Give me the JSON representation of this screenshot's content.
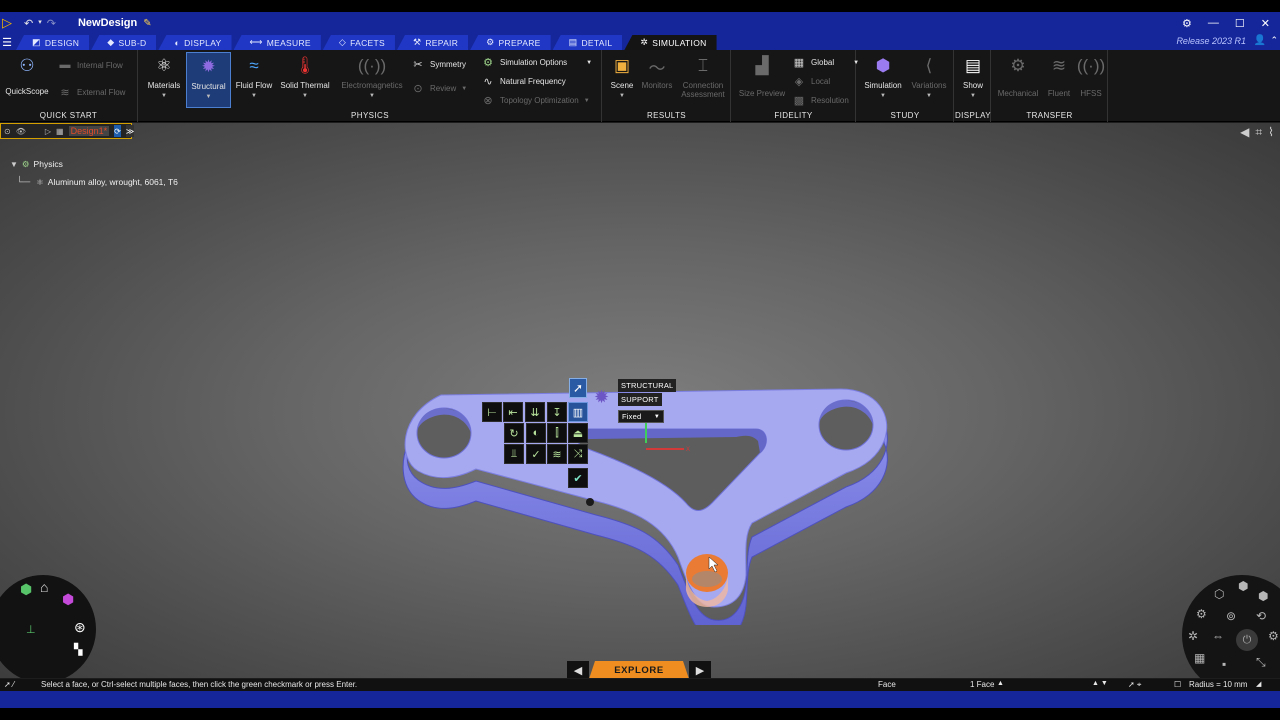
{
  "titlebar": {
    "doc_title": "NewDesign",
    "window_controls": [
      "⚙",
      "—",
      "☐",
      "✕"
    ]
  },
  "tabs": [
    {
      "label": "Design",
      "icon": "design-icon",
      "active": false
    },
    {
      "label": "Sub-D",
      "icon": "subd-icon",
      "active": false
    },
    {
      "label": "Display",
      "icon": "display-icon",
      "active": false
    },
    {
      "label": "Measure",
      "icon": "measure-icon",
      "active": false
    },
    {
      "label": "Facets",
      "icon": "facets-icon",
      "active": false
    },
    {
      "label": "Repair",
      "icon": "repair-icon",
      "active": false
    },
    {
      "label": "Prepare",
      "icon": "prepare-icon",
      "active": false
    },
    {
      "label": "Detail",
      "icon": "detail-icon",
      "active": false
    },
    {
      "label": "Simulation",
      "icon": "simulation-icon",
      "active": true
    }
  ],
  "release": "Release 2023 R1",
  "ribbon": {
    "quick_start": {
      "title": "Quick Start",
      "quickscope": "QuickScope",
      "internal_flow": "Internal Flow",
      "external_flow": "External Flow"
    },
    "physics": {
      "title": "Physics",
      "materials": "Materials",
      "structural": "Structural",
      "fluid_flow": "Fluid Flow",
      "solid_thermal": "Solid Thermal",
      "electromagnetics": "Electromagnetics",
      "symmetry": "Symmetry",
      "review": "Review",
      "simulation_options": "Simulation Options",
      "natural_frequency": "Natural Frequency",
      "topology_optimization": "Topology Optimization"
    },
    "results": {
      "title": "Results",
      "scene": "Scene",
      "monitors": "Monitors",
      "connection_assessment_1": "Connection",
      "connection_assessment_2": "Assessment"
    },
    "fidelity": {
      "title": "Fidelity",
      "size_preview": "Size Preview",
      "global": "Global",
      "local": "Local",
      "resolution": "Resolution"
    },
    "study": {
      "title": "Study",
      "simulation": "Simulation",
      "variations": "Variations"
    },
    "display": {
      "title": "Display",
      "show": "Show"
    },
    "transfer": {
      "title": "Transfer",
      "mechanical": "Mechanical",
      "fluent": "Fluent",
      "hfss": "HFSS"
    }
  },
  "design_tab": {
    "name": "Design1*"
  },
  "tree": {
    "root": "Physics",
    "material": "Aluminum alloy, wrought, 6061, T6"
  },
  "tooltip": {
    "line1": "Structural",
    "line2": "Support",
    "dropdown_value": "Fixed"
  },
  "axes": {
    "y": "Y",
    "x": "X"
  },
  "explore": {
    "label": "Explore"
  },
  "status": {
    "hint": "Select a face, or Ctrl-select multiple faces, then click the green checkmark or press Enter.",
    "selection_type": "Face",
    "selection_count": "1 Face",
    "radius": "Radius = 10 mm"
  },
  "colors": {
    "brand_blue": "#15269a",
    "part_fill": "#a6a8f0",
    "part_edge": "#6f72d9",
    "selected_face": "#e8793a",
    "explore_accent": "#ef8d20"
  }
}
